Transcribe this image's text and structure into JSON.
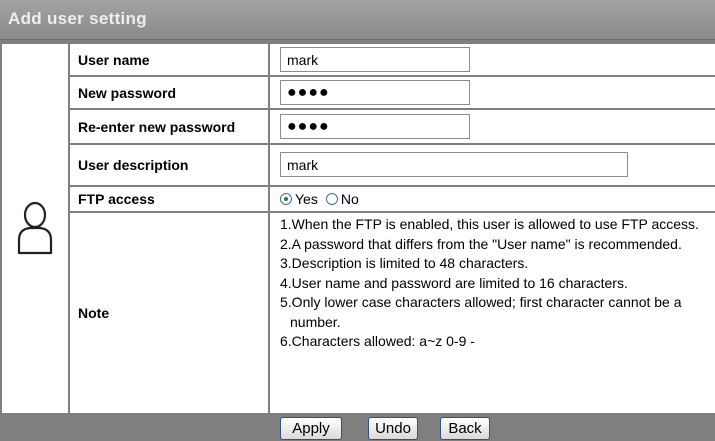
{
  "header": {
    "title": "Add user setting"
  },
  "icons": {
    "user": "user-icon"
  },
  "form": {
    "username": {
      "label": "User name",
      "value": "mark"
    },
    "new_password": {
      "label": "New password",
      "value": "●●●●"
    },
    "reenter_password": {
      "label": "Re-enter new password",
      "value": "●●●●"
    },
    "description": {
      "label": "User description",
      "value": "mark"
    },
    "ftp": {
      "label": "FTP access",
      "yes_label": "Yes",
      "no_label": "No",
      "selected": "Yes"
    },
    "note": {
      "label": "Note",
      "items": [
        "1.When the FTP is enabled, this user is allowed to use FTP access.",
        "2.A password that differs from the \"User name\" is recommended.",
        "3.Description is limited to 48 characters.",
        "4.User name and password are limited to 16 characters.",
        "5.Only lower case characters allowed; first character cannot be a number.",
        "6.Characters allowed: a~z 0-9 -"
      ]
    }
  },
  "actions": {
    "apply": "Apply",
    "undo": "Undo",
    "back": "Back"
  },
  "colors": {
    "header_bg": "#8a8a8a",
    "header_text": "#eeeeee",
    "grid": "#7f7f7f"
  }
}
